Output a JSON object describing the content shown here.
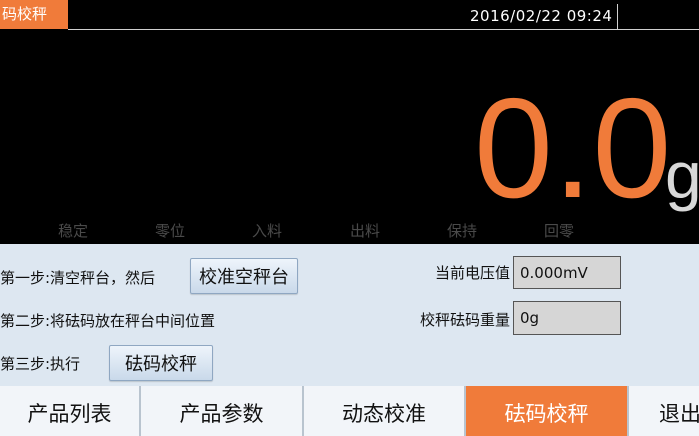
{
  "header": {
    "title": "码校秤",
    "datetime": "2016/02/22  09:24"
  },
  "display": {
    "weight": "0.0",
    "unit": "g"
  },
  "indicators": [
    {
      "label": "稳定"
    },
    {
      "label": "零位"
    },
    {
      "label": "入料"
    },
    {
      "label": "出料"
    },
    {
      "label": "保持"
    },
    {
      "label": "回零"
    }
  ],
  "steps": {
    "step1_text": "第一步:清空秤台，然后",
    "step1_button": "校准空秤台",
    "step2_text": "第二步:将砝码放在秤台中间位置",
    "step3_text": "第三步:执行",
    "step3_button": "砝码校秤"
  },
  "fields": {
    "voltage_label": "当前电压值",
    "voltage_value": "0.000mV",
    "weight_label": "校秤砝码重量",
    "weight_value": "0g"
  },
  "nav": {
    "items": [
      {
        "label": "产品列表"
      },
      {
        "label": "产品参数"
      },
      {
        "label": "动态校准"
      },
      {
        "label": "砝码校秤"
      },
      {
        "label": "退出"
      }
    ],
    "active_index": 3
  },
  "colors": {
    "accent": "#f07b3a",
    "panel": "#dde7f1",
    "background": "#000000"
  }
}
